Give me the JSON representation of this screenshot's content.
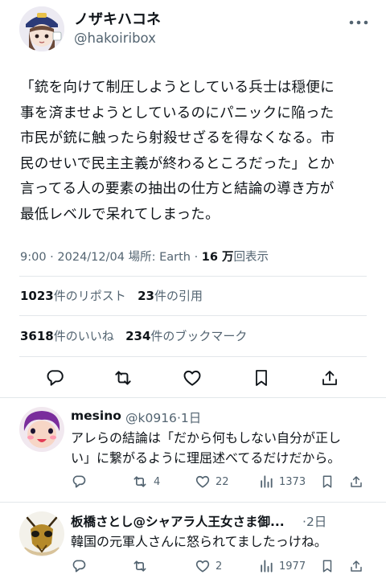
{
  "tweet": {
    "author_name": "ノザキハコネ",
    "author_handle": "@hakoiribox",
    "text_lines": [
      "「銃を向けて制圧しようとしている兵士は穏便に",
      "事を済ませようとしているのにパニックに陥った",
      "市民が銃に触ったら射殺せざるを得なくなる。市",
      "民のせいで民主主義が終わるところだった」とか",
      "言ってる人の要素の抽出の仕方と結論の導き方が",
      "最低レベルで呆れてしまった。"
    ],
    "time": "9:00",
    "date": "2024/12/04",
    "location_label": "場所: Earth",
    "views": "16 万",
    "views_label": "回表示",
    "reposts": "1023",
    "reposts_label": "件のリポスト",
    "quotes": "23",
    "quotes_label": "件の引用",
    "likes": "3618",
    "likes_label": "件のいいね",
    "bookmarks": "234",
    "bookmarks_label": "件のブックマーク"
  },
  "replies": [
    {
      "name": "mesino",
      "handle": "@k0916",
      "age": "1日",
      "text_lines": [
        "アレらの結論は「だから何もしない自分が正し",
        "い」に繋がるように理屈述べてるだけだから。"
      ],
      "reposts": "4",
      "likes": "22",
      "views": "1373"
    },
    {
      "name": "板橋さとし@シャアラ人王女さま御...",
      "handle": "",
      "age": "2日",
      "text_lines": [
        "韓国の元軍人さんに怒られてましたっけね。"
      ],
      "reposts": "",
      "likes": "2",
      "views": "1977"
    }
  ],
  "icons": {
    "more": "more-dots-icon",
    "reply": "reply-bubble-icon",
    "repost": "repost-arrows-icon",
    "like": "heart-icon",
    "bookmark": "bookmark-icon",
    "share": "share-upload-icon",
    "views": "views-bar-chart-icon"
  },
  "colors": {
    "text": "#0f1419",
    "muted": "#536471",
    "divider": "#e3e7ea"
  }
}
